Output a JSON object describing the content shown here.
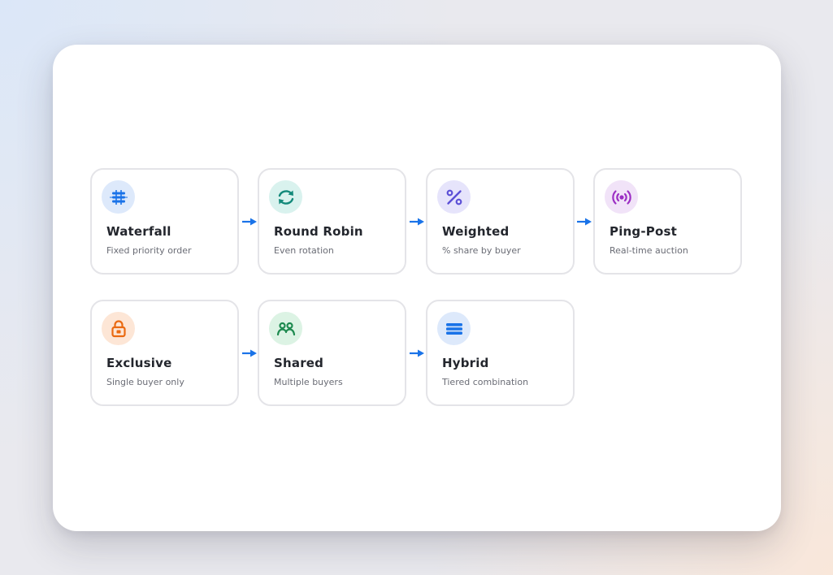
{
  "accent_color": "#1a73e8",
  "nodes": [
    {
      "id": "waterfall",
      "title": "Waterfall",
      "subtitle": "Fixed priority order",
      "icon": "waterfall-icon",
      "icon_bg": "#dde9fb",
      "icon_color": "#1a73e8"
    },
    {
      "id": "round-robin",
      "title": "Round Robin",
      "subtitle": "Even rotation",
      "icon": "rotation-icon",
      "icon_bg": "#d9f2ee",
      "icon_color": "#13897a"
    },
    {
      "id": "weighted",
      "title": "Weighted",
      "subtitle": "% share by buyer",
      "icon": "percent-icon",
      "icon_bg": "#e6e4fb",
      "icon_color": "#5b4fd6"
    },
    {
      "id": "ping-post",
      "title": "Ping-Post",
      "subtitle": "Real-time auction",
      "icon": "broadcast-icon",
      "icon_bg": "#f1e3f8",
      "icon_color": "#9c2fc4"
    },
    {
      "id": "exclusive",
      "title": "Exclusive",
      "subtitle": "Single buyer only",
      "icon": "lock-icon",
      "icon_bg": "#fde6d6",
      "icon_color": "#ea6a12"
    },
    {
      "id": "shared",
      "title": "Shared",
      "subtitle": "Multiple buyers",
      "icon": "people-icon",
      "icon_bg": "#dcf3e4",
      "icon_color": "#1d8a4f"
    },
    {
      "id": "hybrid",
      "title": "Hybrid",
      "subtitle": "Tiered combination",
      "icon": "layers-icon",
      "icon_bg": "#dde9fb",
      "icon_color": "#1a73e8"
    }
  ],
  "edges": [
    {
      "from": "waterfall",
      "to": "round-robin"
    },
    {
      "from": "round-robin",
      "to": "weighted"
    },
    {
      "from": "weighted",
      "to": "ping-post"
    },
    {
      "from": "exclusive",
      "to": "shared"
    },
    {
      "from": "shared",
      "to": "hybrid"
    }
  ]
}
